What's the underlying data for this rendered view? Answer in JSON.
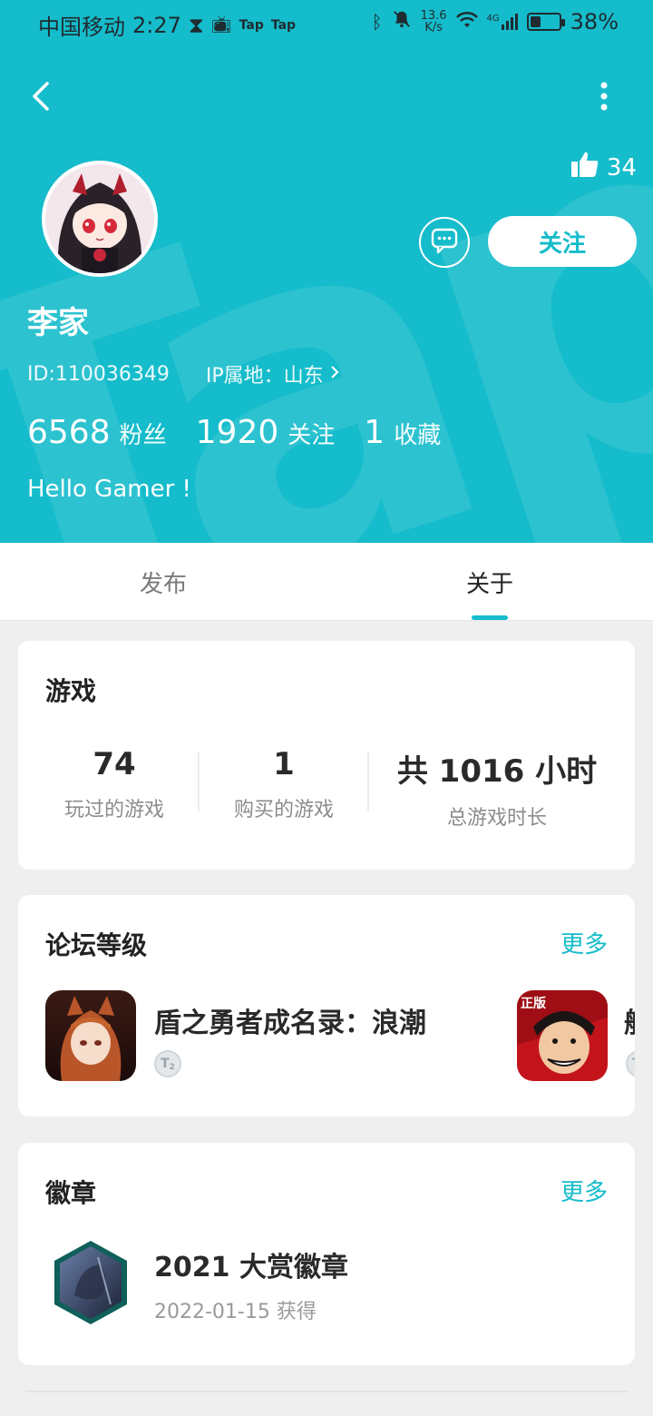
{
  "status_bar": {
    "carrier": "中国移动",
    "time": "2:27",
    "app_tags": [
      "Tap",
      "Tap"
    ],
    "speed_value": "13.6",
    "speed_unit": "K/s",
    "network": "4G",
    "battery": "38%",
    "battery_level": 0.38
  },
  "header": {
    "like_count": "34",
    "follow_label": "关注",
    "username": "李家",
    "user_id": "ID:110036349",
    "ip_location": "IP属地：山东",
    "bio": "Hello Gamer !",
    "watermark_text": "TapTap",
    "stats": [
      {
        "value": "6568",
        "label": "粉丝"
      },
      {
        "value": "1920",
        "label": "关注"
      },
      {
        "value": "1",
        "label": "收藏"
      }
    ]
  },
  "tabs": [
    {
      "label": "发布",
      "active": false
    },
    {
      "label": "关于",
      "active": true
    }
  ],
  "games_card": {
    "title": "游戏",
    "items": [
      {
        "value": "74",
        "label": "玩过的游戏"
      },
      {
        "value": "1",
        "label": "购买的游戏"
      },
      {
        "value": "共 1016 小时",
        "label": "总游戏时长"
      }
    ]
  },
  "forum_card": {
    "title": "论坛等级",
    "more": "更多",
    "games": [
      {
        "name": "盾之勇者成名录：浪潮",
        "level": "2"
      },
      {
        "name": "航",
        "tag": "正版",
        "level": "2"
      }
    ]
  },
  "badge_card": {
    "title": "徽章",
    "more": "更多",
    "badge_name": "2021 大赏徽章",
    "badge_date": "2022-01-15 获得"
  },
  "colors": {
    "accent": "#15bccb",
    "page_bg": "#efefef"
  }
}
